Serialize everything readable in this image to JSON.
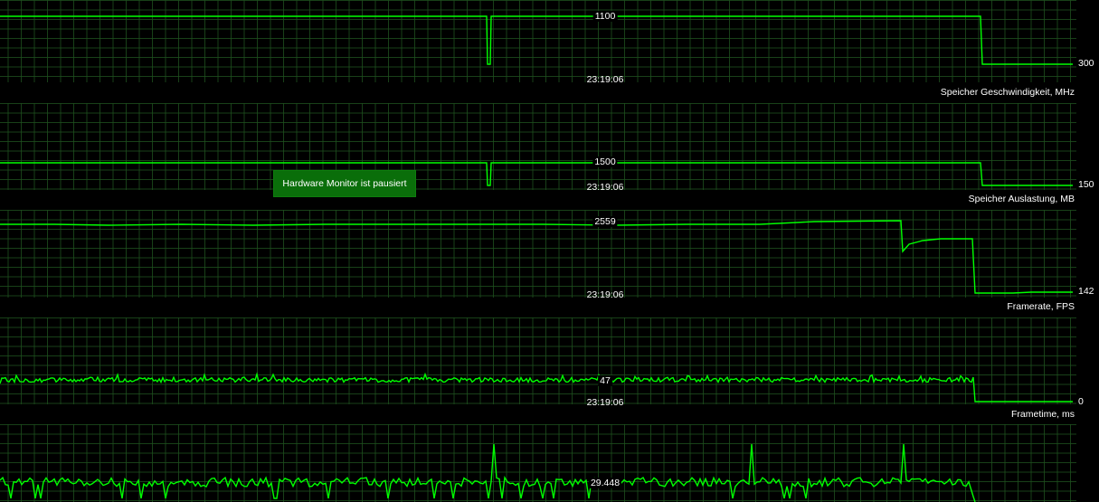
{
  "app": {
    "paused_message": "Hardware Monitor ist pausiert"
  },
  "graphs": [
    {
      "title": "Speicher Geschwindigkeit, MHz",
      "current_value": "1100",
      "timestamp": "23:19:06",
      "end_value": "300"
    },
    {
      "title": "Speicher Auslastung, MB",
      "current_value": "1500",
      "timestamp": "23:19:06",
      "end_value": "150"
    },
    {
      "title": "Framerate, FPS",
      "current_value": "2559",
      "timestamp": "23:19:06",
      "end_value": "142"
    },
    {
      "title": "Frametime, ms",
      "current_value": "47",
      "timestamp": "23:19:06",
      "end_value": "0"
    },
    {
      "title": "",
      "current_value": "29.448",
      "timestamp": "",
      "end_value": ""
    }
  ],
  "colors": {
    "background": "#000000",
    "grid": "#1e501e",
    "trace": "#00ff00",
    "paused_badge": "#0a6e0a",
    "text": "#ffffff"
  }
}
